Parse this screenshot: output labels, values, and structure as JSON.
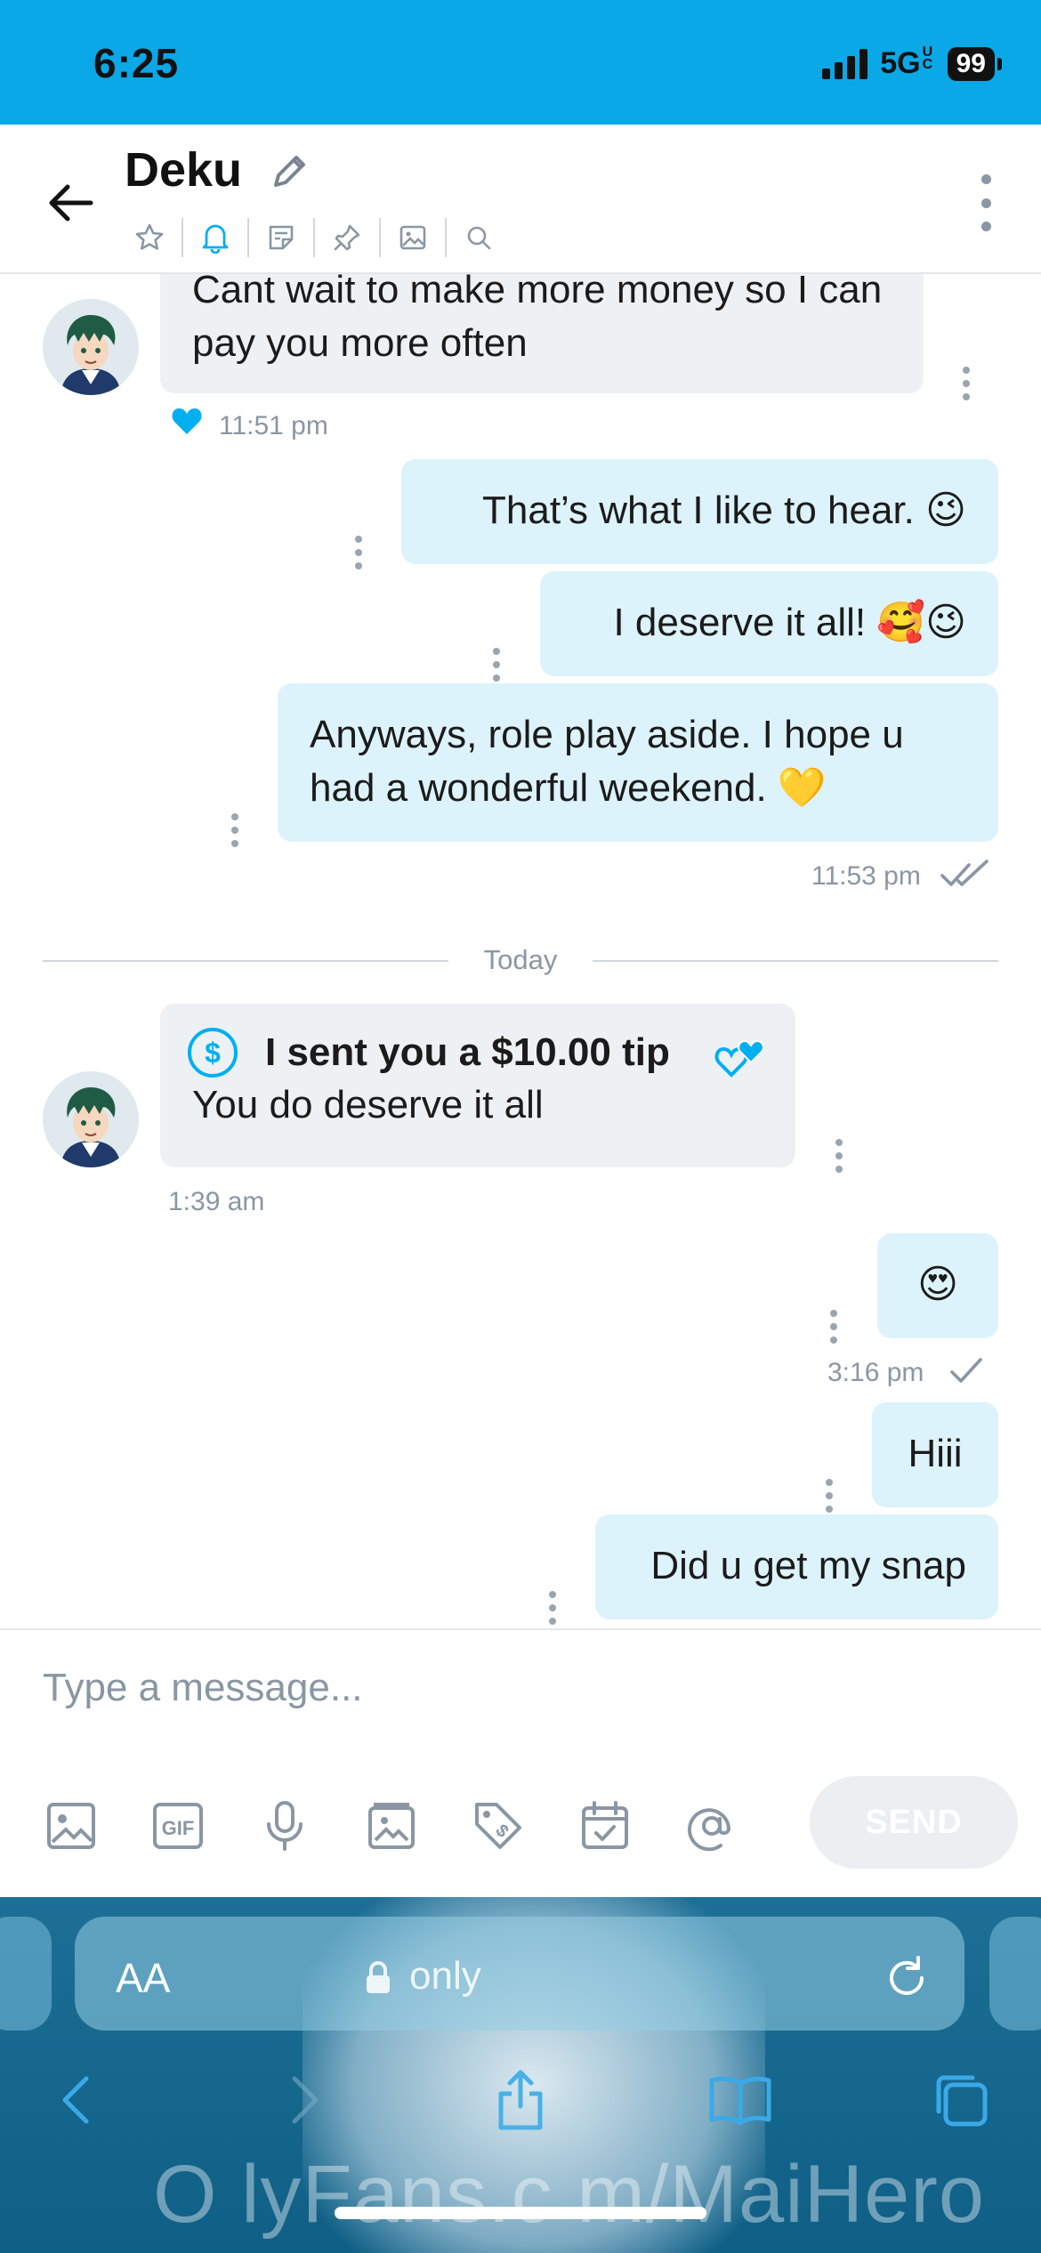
{
  "status_bar": {
    "time": "6:25",
    "network": "5G",
    "network_suffix": "UC",
    "battery": "99"
  },
  "header": {
    "contact_name": "Deku"
  },
  "messages": [
    {
      "direction": "in",
      "text": "Cant wait to make more money so I can pay you more often",
      "time": "11:51 pm",
      "liked": true
    },
    {
      "direction": "out",
      "text": "That’s what I like to hear. 😉"
    },
    {
      "direction": "out",
      "text": "I deserve it all! 🥰😉"
    },
    {
      "direction": "out",
      "text": "Anyways, role play aside. I hope u had a wonderful weekend. 💛",
      "time": "11:53 pm",
      "status": "read"
    },
    {
      "direction": "in",
      "type": "tip",
      "tip_title": "I sent you a $10.00 tip",
      "text": "You do deserve it all",
      "time": "1:39 am"
    },
    {
      "direction": "out",
      "text": "😍",
      "time": "3:16 pm",
      "status": "sent"
    },
    {
      "direction": "out",
      "text": "Hiii"
    },
    {
      "direction": "out",
      "text": "Did u get my snap"
    }
  ],
  "day_divider": "Today",
  "composer": {
    "placeholder": "Type a message...",
    "send_label": "SEND",
    "gif_label": "GIF"
  },
  "browser": {
    "aa_label": "AA",
    "url": "only",
    "watermark": "O lyFans.c m/MaiHero"
  },
  "colors": {
    "accent": "#00aff0",
    "status_bar": "#0aa8e6",
    "bubble_in": "#eef1f4",
    "bubble_out": "#ddf3fb",
    "muted": "#8a96a3"
  }
}
